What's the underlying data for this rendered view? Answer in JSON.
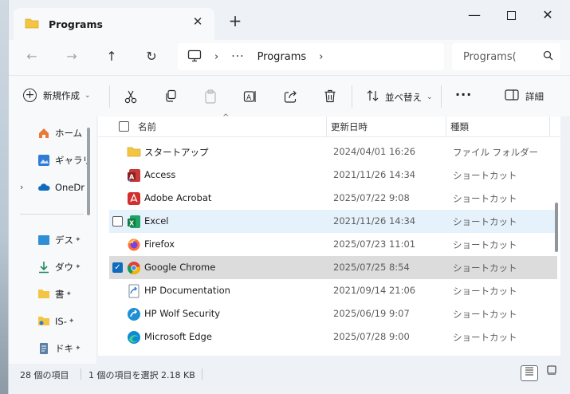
{
  "window": {
    "tab_title": "Programs",
    "tab_close": "✕",
    "new_tab": "+",
    "minimize": "—",
    "close": "✕"
  },
  "nav": {
    "back": "←",
    "forward": "→",
    "up": "↑",
    "refresh": "↻",
    "breadcrumb_sep": "›",
    "ellipsis": "···",
    "crumb": "Programs",
    "crumb_sep2": "›",
    "search_placeholder": "Programs(",
    "search_icon": "search-icon"
  },
  "toolbar": {
    "new_label": "新規作成",
    "new_chevron": "⌄",
    "sort_label": "並べ替え",
    "sort_chevron": "⌄",
    "more": "···",
    "details_label": "詳細"
  },
  "sidebar": {
    "items": [
      {
        "label": "ホーム",
        "icon": "home-icon"
      },
      {
        "label": "ギャラリ",
        "icon": "gallery-icon"
      },
      {
        "label": "OneDr",
        "icon": "cloud-icon"
      },
      {
        "label": "デス",
        "icon": "desktop-icon"
      },
      {
        "label": "ダウ",
        "icon": "download-icon"
      },
      {
        "label": "書",
        "icon": "folder-icon"
      },
      {
        "label": "IS-",
        "icon": "folder-icon"
      },
      {
        "label": "ドキ",
        "icon": "documents-icon"
      }
    ],
    "onedrive_chevron": "›",
    "pin": "📌"
  },
  "list": {
    "columns": {
      "name": "名前",
      "date": "更新日時",
      "type": "種類"
    },
    "sort_caret": "^",
    "rows": [
      {
        "name": "スタートアップ",
        "date": "2024/04/01 16:26",
        "type": "ファイル フォルダー",
        "icon": "folder-icon"
      },
      {
        "name": "Access",
        "date": "2021/11/26 14:34",
        "type": "ショートカット",
        "icon": "access-icon"
      },
      {
        "name": "Adobe Acrobat",
        "date": "2025/07/22 9:08",
        "type": "ショートカット",
        "icon": "acrobat-icon"
      },
      {
        "name": "Excel",
        "date": "2021/11/26 14:34",
        "type": "ショートカット",
        "icon": "excel-icon"
      },
      {
        "name": "Firefox",
        "date": "2025/07/23 11:01",
        "type": "ショートカット",
        "icon": "firefox-icon"
      },
      {
        "name": "Google Chrome",
        "date": "2025/07/25 8:54",
        "type": "ショートカット",
        "icon": "chrome-icon"
      },
      {
        "name": "HP Documentation",
        "date": "2021/09/14 21:06",
        "type": "ショートカット",
        "icon": "shortcut-icon"
      },
      {
        "name": "HP Wolf Security",
        "date": "2025/06/19 9:07",
        "type": "ショートカット",
        "icon": "wolf-security-icon"
      },
      {
        "name": "Microsoft Edge",
        "date": "2025/07/28 9:00",
        "type": "ショートカット",
        "icon": "edge-icon"
      }
    ],
    "checkmark": "✓"
  },
  "status": {
    "count": "28 個の項目",
    "selection": "1 個の項目を選択  2.18 KB"
  },
  "colors": {
    "accent": "#0f6cbd",
    "hover_row": "#e5f1fb",
    "selected_row": "#dcdcdc",
    "folder": "#f4c542"
  }
}
